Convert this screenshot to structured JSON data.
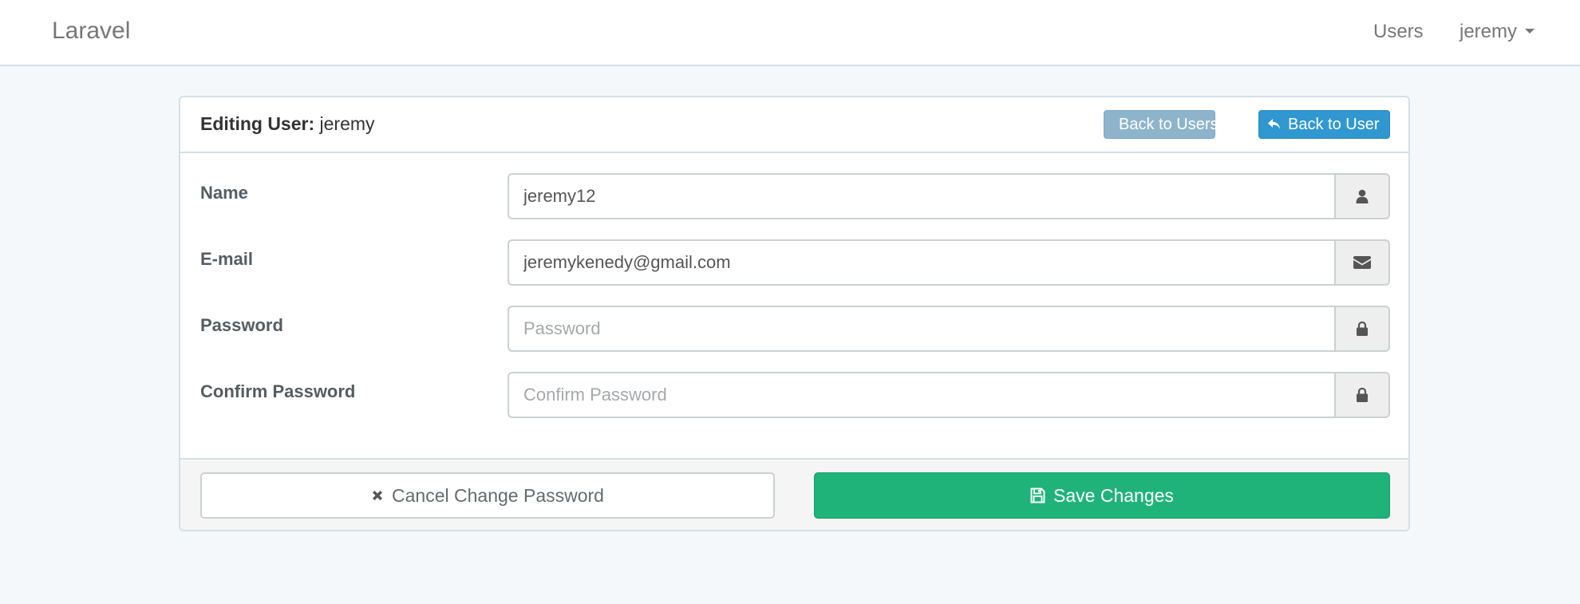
{
  "navbar": {
    "brand": "Laravel",
    "links": [
      {
        "label": "Users"
      },
      {
        "label": "jeremy",
        "icon": "caret-down-icon"
      }
    ]
  },
  "panel": {
    "heading_label": "Editing User:",
    "heading_value": "jeremy",
    "buttons": [
      {
        "label": "Back to Users",
        "icon": "reply-icon",
        "color": "#8eb4cb"
      },
      {
        "label": "Back to User",
        "icon": "reply-icon",
        "color": "#3097d1"
      }
    ]
  },
  "form": {
    "fields": [
      {
        "label": "Name",
        "value": "jeremy12",
        "placeholder": "",
        "icon": "user-icon"
      },
      {
        "label": "E-mail",
        "value": "jeremykenedy@gmail.com",
        "placeholder": "",
        "icon": "envelope-icon"
      },
      {
        "label": "Password",
        "value": "",
        "placeholder": "Password",
        "icon": "lock-icon"
      },
      {
        "label": "Confirm Password",
        "value": "",
        "placeholder": "Confirm Password",
        "icon": "lock-icon"
      }
    ]
  },
  "footer": {
    "cancel_label": "Cancel Change Password",
    "cancel_icon": "times-icon",
    "save_label": "Save Changes",
    "save_icon": "floppy-disk-icon",
    "save_color": "#1fb37a"
  }
}
